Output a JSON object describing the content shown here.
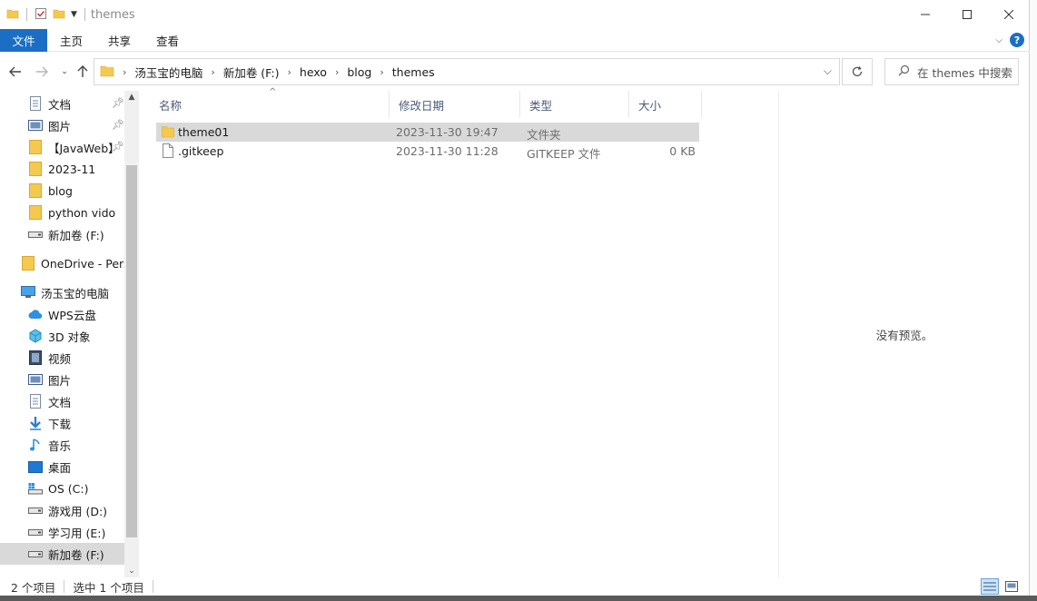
{
  "window": {
    "title": "themes",
    "controls": {
      "minimize_icon": "minimize-icon",
      "maximize_icon": "maximize-icon",
      "close_icon": "close-icon"
    }
  },
  "ribbon": {
    "tabs": [
      {
        "label": "文件",
        "active": true
      },
      {
        "label": "主页"
      },
      {
        "label": "共享"
      },
      {
        "label": "查看"
      }
    ],
    "help_label": "?"
  },
  "address": {
    "crumbs": [
      "汤玉宝的电脑",
      "新加卷 (F:)",
      "hexo",
      "blog",
      "themes"
    ],
    "search_placeholder": "在 themes 中搜索"
  },
  "sidebar": {
    "items": [
      {
        "label": "文档",
        "icon": "documents-icon",
        "pinned": true
      },
      {
        "label": "图片",
        "icon": "pictures-icon",
        "pinned": true
      },
      {
        "label": "【JavaWeb】",
        "icon": "folder-icon",
        "pinned": true
      },
      {
        "label": "2023-11",
        "icon": "folder-icon"
      },
      {
        "label": "blog",
        "icon": "folder-icon"
      },
      {
        "label": "python vido",
        "icon": "folder-icon"
      },
      {
        "label": "新加卷 (F:)",
        "icon": "drive-icon"
      },
      {
        "label": "OneDrive - Perso",
        "icon": "onedrive-folder-icon"
      },
      {
        "label": "汤玉宝的电脑",
        "icon": "computer-icon"
      },
      {
        "label": "WPS云盘",
        "icon": "cloud-icon"
      },
      {
        "label": "3D 对象",
        "icon": "3d-objects-icon"
      },
      {
        "label": "视频",
        "icon": "video-icon"
      },
      {
        "label": "图片",
        "icon": "pictures-icon"
      },
      {
        "label": "文档",
        "icon": "documents-icon"
      },
      {
        "label": "下载",
        "icon": "download-icon"
      },
      {
        "label": "音乐",
        "icon": "music-icon"
      },
      {
        "label": "桌面",
        "icon": "desktop-icon"
      },
      {
        "label": "OS (C:)",
        "icon": "os-drive-icon"
      },
      {
        "label": "游戏用 (D:)",
        "icon": "drive-icon"
      },
      {
        "label": "学习用 (E:)",
        "icon": "drive-icon"
      },
      {
        "label": "新加卷 (F:)",
        "icon": "drive-icon",
        "selected": true
      }
    ]
  },
  "filelist": {
    "columns": [
      "名称",
      "修改日期",
      "类型",
      "大小"
    ],
    "rows": [
      {
        "name": "theme01",
        "date": "2023-11-30 19:47",
        "type": "文件夹",
        "size": "",
        "icon": "folder-icon",
        "selected": true
      },
      {
        "name": ".gitkeep",
        "date": "2023-11-30 11:28",
        "type": "GITKEEP 文件",
        "size": "0 KB",
        "icon": "file-icon"
      }
    ]
  },
  "preview": {
    "text": "没有预览。"
  },
  "status": {
    "count": "2 个项目",
    "selection": "选中 1 个项目"
  },
  "colors": {
    "accent": "#1a6fc4",
    "selection": "#d9d9d9",
    "folder": "#f4c94f"
  }
}
